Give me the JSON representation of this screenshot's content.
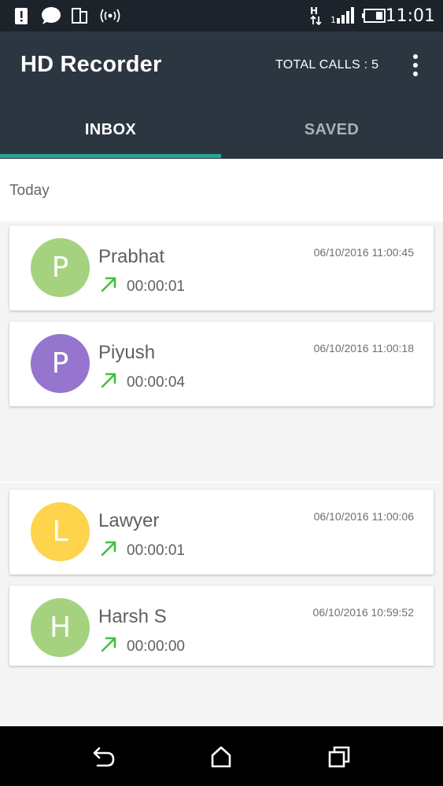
{
  "status_bar": {
    "time": "11:01",
    "icons": [
      "alert-icon",
      "chat-bubble-icon",
      "sim-card-icon",
      "radio-waves-icon",
      "data-transfer-icon",
      "signal-icon",
      "battery-icon"
    ]
  },
  "app_bar": {
    "title": "HD Recorder",
    "total_calls": "TOTAL CALLS : 5"
  },
  "tabs": [
    {
      "label": "INBOX",
      "active": true
    },
    {
      "label": "SAVED",
      "active": false
    }
  ],
  "accent_color": "#26a69a",
  "section": {
    "title": "Today"
  },
  "calls": [
    {
      "initial": "P",
      "name": "Prabhat",
      "datetime": "06/10/2016 11:00:45",
      "duration": "00:00:01",
      "color": "#a5d27f",
      "direction": "outgoing"
    },
    {
      "initial": "P",
      "name": "Piyush",
      "datetime": "06/10/2016 11:00:18",
      "duration": "00:00:04",
      "color": "#9575cd",
      "direction": "outgoing"
    },
    {
      "initial": "L",
      "name": "Lawyer",
      "datetime": "06/10/2016 11:00:06",
      "duration": "00:00:01",
      "color": "#fdd44b",
      "direction": "outgoing"
    },
    {
      "initial": "H",
      "name": "Harsh S",
      "datetime": "06/10/2016 10:59:52",
      "duration": "00:00:00",
      "color": "#a5d27f",
      "direction": "outgoing"
    }
  ],
  "nav_bar": {
    "icons": [
      "back-icon",
      "home-icon",
      "recents-icon"
    ]
  }
}
